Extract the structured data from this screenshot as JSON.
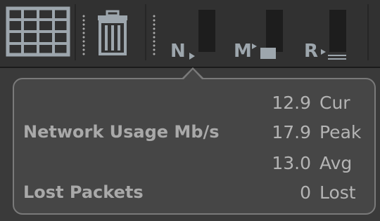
{
  "toolbar": {
    "buttons": [
      {
        "name": "grid-view",
        "icon": "grid-icon"
      },
      {
        "name": "delete",
        "icon": "trash-icon"
      }
    ],
    "meters": [
      {
        "letter": "N",
        "indicator": "play-small-icon"
      },
      {
        "letter": "M",
        "indicator": "flag-block-icon"
      },
      {
        "letter": "R",
        "indicator": "play-lines-icon"
      }
    ]
  },
  "tooltip": {
    "network_label": "Network Usage Mb/s",
    "lost_label": "Lost Packets",
    "stats": [
      {
        "value": "12.9",
        "unit": "Cur"
      },
      {
        "value": "17.9",
        "unit": "Peak"
      },
      {
        "value": "13.0",
        "unit": "Avg"
      },
      {
        "value": "0",
        "unit": "Lost"
      }
    ]
  },
  "colors": {
    "toolbar_bg": "#313131",
    "popup_bg": "#464646",
    "popup_border": "#7a7a7a",
    "text": "#b4b4b4",
    "icon": "#9da6ad"
  }
}
